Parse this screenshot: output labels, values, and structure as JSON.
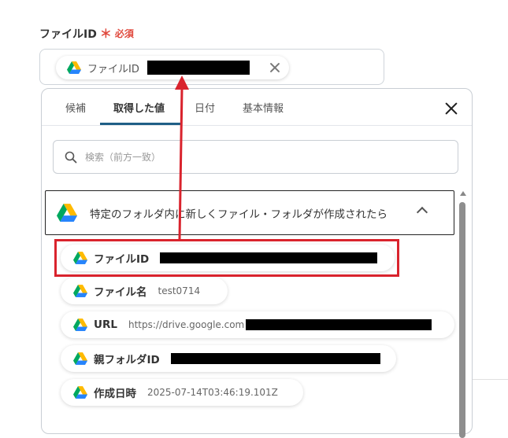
{
  "field": {
    "label": "ファイルID",
    "required_mark": "＊",
    "required_text": "必須",
    "token_label": "ファイルID"
  },
  "tabs": [
    {
      "label": "候補",
      "active": false
    },
    {
      "label": "取得した値",
      "active": true
    },
    {
      "label": "日付",
      "active": false
    },
    {
      "label": "基本情報",
      "active": false
    }
  ],
  "search": {
    "placeholder": "検索（前方一致）"
  },
  "group": {
    "title": "特定のフォルダ内に新しくファイル・フォルダが作成されたら"
  },
  "items": [
    {
      "name": "ファイルID",
      "value": ""
    },
    {
      "name": "ファイル名",
      "value": "test0714"
    },
    {
      "name": "URL",
      "value": "https://drive.google.com"
    },
    {
      "name": "親フォルダID",
      "value": ""
    },
    {
      "name": "作成日時",
      "value": "2025-07-14T03:46:19.101Z"
    }
  ],
  "colors": {
    "required": "#e0493d",
    "tab_underline": "#1f5f86",
    "annotation_red": "#d9232d"
  },
  "icons": {
    "item_icon": "google-drive-icon",
    "search": "search-icon",
    "close": "close-icon",
    "collapse": "chevron-up-icon"
  }
}
